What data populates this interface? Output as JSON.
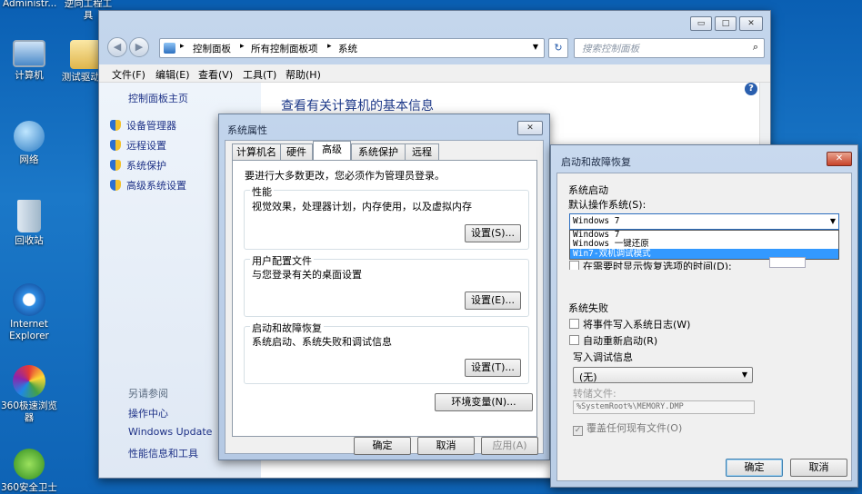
{
  "desktop": {
    "icons": [
      {
        "label": "计算机"
      },
      {
        "label": "测试驱动序"
      },
      {
        "label": "网络"
      },
      {
        "label": "回收站"
      },
      {
        "label": "Internet Explorer"
      },
      {
        "label": "360极速浏览器"
      },
      {
        "label": "360安全卫士"
      }
    ],
    "top_labels": [
      "Administr...",
      "逆向工程工具"
    ]
  },
  "explorer": {
    "breadcrumb": [
      "控制面板",
      "所有控制面板项",
      "系统"
    ],
    "search_placeholder": "搜索控制面板",
    "menu": [
      "文件(F)",
      "编辑(E)",
      "查看(V)",
      "工具(T)",
      "帮助(H)"
    ],
    "left_home": "控制面板主页",
    "left_links": [
      "设备管理器",
      "远程设置",
      "系统保护",
      "高级系统设置"
    ],
    "see_also_title": "另请参阅",
    "see_also": [
      "操作中心",
      "Windows Update",
      "性能信息和工具"
    ],
    "page_title": "查看有关计算机的基本信息"
  },
  "sysprops": {
    "title": "系统属性",
    "tabs": [
      "计算机名",
      "硬件",
      "高级",
      "系统保护",
      "远程"
    ],
    "active_tab": "高级",
    "admin_note": "要进行大多数更改，您必须作为管理员登录。",
    "perf_title": "性能",
    "perf_desc": "视觉效果，处理器计划，内存使用，以及虚拟内存",
    "perf_btn": "设置(S)...",
    "profile_title": "用户配置文件",
    "profile_desc": "与您登录有关的桌面设置",
    "profile_btn": "设置(E)...",
    "startup_title": "启动和故障恢复",
    "startup_desc": "系统启动、系统失败和调试信息",
    "startup_btn": "设置(T)...",
    "env_btn": "环境变量(N)...",
    "ok": "确定",
    "cancel": "取消",
    "apply": "应用(A)"
  },
  "startup": {
    "title": "启动和故障恢复",
    "system_startup": "系统启动",
    "default_os_label": "默认操作系统(S):",
    "default_os_value": "Windows 7",
    "os_options": [
      "Windows 7",
      "Windows 一键还原",
      "Win7-双机调试模式"
    ],
    "show_recovery": "在需要时显示恢复选项的时间(D):",
    "system_failure": "系统失败",
    "write_event": "将事件写入系统日志(W)",
    "auto_restart": "自动重新启动(R)",
    "debug_info": "写入调试信息",
    "debug_value": "(无)",
    "dump_file_label": "转储文件:",
    "dump_file_value": "%SystemRoot%\\MEMORY.DMP",
    "overwrite": "覆盖任何现有文件(O)",
    "ok": "确定",
    "cancel": "取消"
  }
}
